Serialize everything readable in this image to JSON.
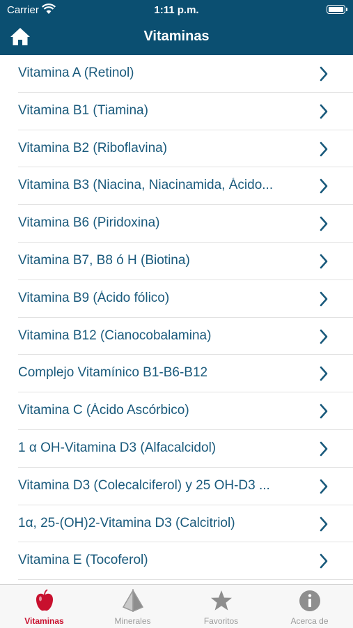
{
  "status_bar": {
    "carrier": "Carrier",
    "time": "1:11 p.m."
  },
  "nav": {
    "title": "Vitaminas",
    "home_icon": "home-icon"
  },
  "list": {
    "items": [
      {
        "label": "Vitamina A (Retinol)"
      },
      {
        "label": "Vitamina B1 (Tiamina)"
      },
      {
        "label": "Vitamina B2 (Riboflavina)"
      },
      {
        "label": "Vitamina B3 (Niacina, Niacinamida, Ácido..."
      },
      {
        "label": "Vitamina B6 (Piridoxina)"
      },
      {
        "label": "Vitamina B7, B8 ó H (Biotina)"
      },
      {
        "label": "Vitamina B9 (Ácido fólico)"
      },
      {
        "label": "Vitamina B12 (Cianocobalamina)"
      },
      {
        "label": "Complejo Vitamínico B1-B6-B12"
      },
      {
        "label": "Vitamina C (Ácido Ascórbico)"
      },
      {
        "label": "1 α OH-Vitamina D3 (Alfacalcidol)"
      },
      {
        "label": "Vitamina D3 (Colecalciferol) y 25 OH-D3 ..."
      },
      {
        "label": "1α, 25-(OH)2-Vitamina D3 (Calcitriol)"
      },
      {
        "label": "Vitamina E (Tocoferol)"
      }
    ]
  },
  "tabs": [
    {
      "label": "Vitaminas",
      "icon": "apple-icon",
      "active": true
    },
    {
      "label": "Minerales",
      "icon": "pyramid-icon",
      "active": false
    },
    {
      "label": "Favoritos",
      "icon": "star-icon",
      "active": false
    },
    {
      "label": "Acerca de",
      "icon": "info-icon",
      "active": false
    }
  ],
  "colors": {
    "header_bg": "#0b4f71",
    "list_text": "#1a5a7c",
    "active_tab": "#c8102e",
    "inactive_tab": "#9a9a9a"
  }
}
